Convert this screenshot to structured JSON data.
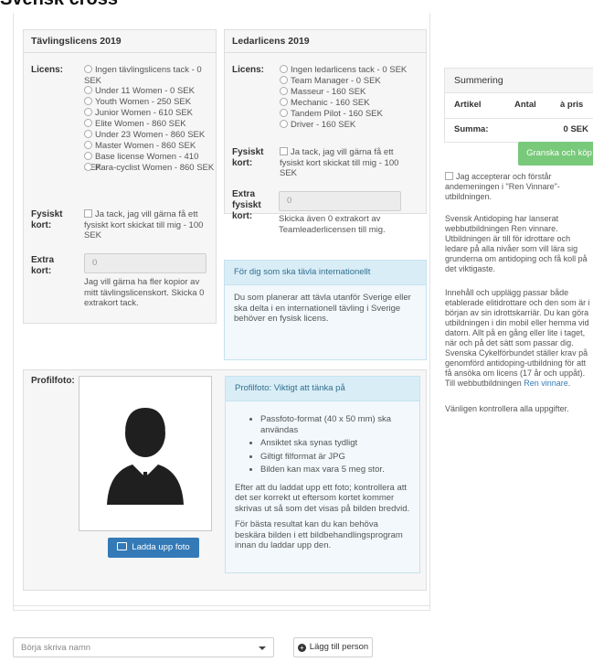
{
  "page": {
    "title": "Svensk cross"
  },
  "tavlingslicens": {
    "header": "Tävlingslicens 2019",
    "licens_label": "Licens:",
    "options": [
      "Ingen tävlingslicens tack - 0 SEK",
      "Under 11 Women - 0 SEK",
      "Youth Women - 250 SEK",
      "Junior Women - 610 SEK",
      "Elite Women - 860 SEK",
      "Under 23 Women - 860 SEK",
      "Master Women - 860 SEK",
      "Base license Women - 410 SEK",
      "Para-cyclist Women - 860 SEK"
    ],
    "fysiskt_label_1": "Fysiskt",
    "fysiskt_label_2": "kort:",
    "fysiskt_checkbox": "Ja tack, jag vill gärna få ett fysiskt kort skickat till mig - 100 SEK",
    "extra_label_1": "Extra",
    "extra_label_2": "kort:",
    "extra_value": "0",
    "extra_help": "Jag vill gärna ha fler kopior av mitt tävlingslicenskort. Skicka 0 extrakort tack."
  },
  "ledarlicens": {
    "header": "Ledarlicens 2019",
    "licens_label": "Licens:",
    "options": [
      "Ingen ledarlicens tack - 0 SEK",
      "Team Manager - 0 SEK",
      "Masseur - 160 SEK",
      "Mechanic - 160 SEK",
      "Tandem Pilot - 160 SEK",
      "Driver - 160 SEK"
    ],
    "fysiskt_label_1": "Fysiskt",
    "fysiskt_label_2": "kort:",
    "fysiskt_checkbox": "Ja tack, jag vill gärna få ett fysiskt kort skickat till mig - 100 SEK",
    "extra_label_1": "Extra",
    "extra_label_2": "fysiskt",
    "extra_label_3": "kort:",
    "extra_value": "0",
    "extra_help": "Skicka även 0 extrakort av Teamleaderlicensen till mig."
  },
  "international": {
    "header": "För dig som ska tävla internationellt",
    "body": "Du som planerar att tävla utanför Sverige eller ska delta i en internationell tävling i Sverige behöver en fysisk licens."
  },
  "profilfoto": {
    "label": "Profilfoto:",
    "upload_button": "Ladda upp foto",
    "info_header": "Profilfoto: Viktigt att tänka på",
    "bullets": [
      "Passfoto-format (40 x 50 mm) ska användas",
      "Ansiktet ska synas tydligt",
      "Giltigt filformat är JPG",
      "Bilden kan max vara 5 meg stor."
    ],
    "para1": "Efter att du laddat upp ett foto; kontrollera att det ser korrekt ut eftersom kortet kommer skrivas ut så som det visas på bilden bredvid.",
    "para2": "För bästa resultat kan du kan behöva beskära bilden i ett bildbehandlingsprogram innan du laddar upp den."
  },
  "summary": {
    "header": "Summering",
    "col_artikel": "Artikel",
    "col_antal": "Antal",
    "col_apris": "à pris",
    "summa_label": "Summa:",
    "summa_value": "0 SEK",
    "button": "Granska och köp"
  },
  "sidebar": {
    "accept": "Jag accepterar och förstår andemeningen i \"Ren Vinnare\"-utbildningen.",
    "para1": "Svensk Antidoping har lanserat webbutbildningen Ren vinnare. Utbildningen är till för idrottare och ledare på alla nivåer som vill lära sig grunderna om antidoping och få koll på det viktigaste.",
    "para2_pre": "Innehåll och upplägg passar både etablerade elitidrottare och den som är i början av sin idrottskarriär. Du kan göra utbildningen i din mobil eller hemma vid datorn. Allt på en gång eller lite i taget, när och på det sätt som passar dig. Svenska Cykelförbundet ställer krav på genomförd antidoping-utbildning för att få ansöka om licens (17 år och uppåt). Till webbutbildningen ",
    "para2_link": "Ren vinnare",
    "para2_post": ".",
    "para3": "Vänligen kontrollera alla uppgifter."
  },
  "footer": {
    "select_placeholder": "Börja skriva namn",
    "add_button": "Lägg till person"
  },
  "colors": {
    "primary": "#337ab7",
    "success": "#78c97a",
    "info_bg": "#d9edf7",
    "info_text": "#31708f"
  }
}
